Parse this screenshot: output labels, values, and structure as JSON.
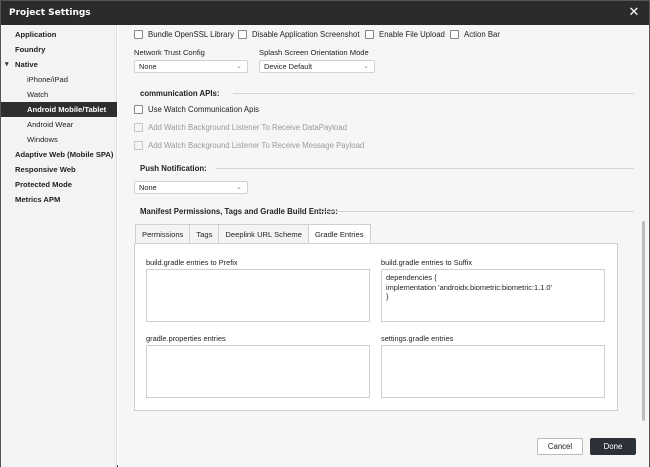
{
  "window": {
    "title": "Project Settings"
  },
  "sidebar": {
    "items": [
      {
        "label": "Application",
        "level": 0
      },
      {
        "label": "Foundry",
        "level": 0
      },
      {
        "label": "Native",
        "level": 0,
        "expanded": true
      },
      {
        "label": "iPhone/iPad",
        "level": 1
      },
      {
        "label": "Watch",
        "level": 1
      },
      {
        "label": "Android Mobile/Tablet",
        "level": 1,
        "selected": true
      },
      {
        "label": "Android Wear",
        "level": 1
      },
      {
        "label": "Windows",
        "level": 1
      },
      {
        "label": "Adaptive Web (Mobile SPA)",
        "level": 0
      },
      {
        "label": "Responsive Web",
        "level": 0
      },
      {
        "label": "Protected Mode",
        "level": 0
      },
      {
        "label": "Metrics APM",
        "level": 0
      }
    ]
  },
  "top_checkboxes": [
    {
      "label": "Bundle OpenSSL Library",
      "checked": false
    },
    {
      "label": "Disable Application Screenshot",
      "checked": false
    },
    {
      "label": "Enable File Upload",
      "checked": false
    },
    {
      "label": "Action Bar",
      "checked": false
    }
  ],
  "network_trust": {
    "label": "Network Trust Config",
    "value": "None"
  },
  "splash_orientation": {
    "label": "Splash Screen Orientation Mode",
    "value": "Device Default"
  },
  "communication": {
    "title": "communication APIs:",
    "options": [
      {
        "label": "Use Watch Communication Apis",
        "checked": false,
        "disabled": false
      },
      {
        "label": "Add Watch Background Listener To Receive DataPayload",
        "checked": false,
        "disabled": true
      },
      {
        "label": "Add Watch Background Listener To Receive Message Payload",
        "checked": false,
        "disabled": true
      }
    ]
  },
  "push": {
    "title": "Push Notification:",
    "value": "None"
  },
  "manifest": {
    "title": "Manifest Permissions, Tags and Gradle Build Entries:",
    "tabs": [
      {
        "label": "Permissions",
        "active": false
      },
      {
        "label": "Tags",
        "active": false
      },
      {
        "label": "Deeplink URL Scheme",
        "active": false
      },
      {
        "label": "Gradle Entries",
        "active": true
      }
    ],
    "gradle": {
      "prefix_label": "build.gradle entries to Prefix",
      "prefix_value": "",
      "suffix_label": "build.gradle entries to Suffix",
      "suffix_value": "dependencies {\nimplementation 'androidx.biometric:biometric:1.1.0'\n}",
      "properties_label": "gradle.properties entries",
      "properties_value": "",
      "settings_label": "settings.gradle entries",
      "settings_value": ""
    }
  },
  "buttons": {
    "cancel": "Cancel",
    "done": "Done"
  }
}
